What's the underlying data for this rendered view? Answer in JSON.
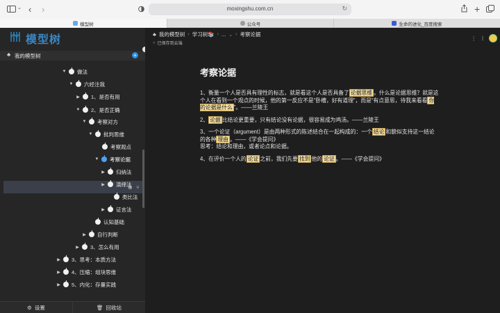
{
  "browser": {
    "url": "moxingshu.com.cn",
    "tabs": [
      {
        "label": "模型树",
        "color": "#6aa8e8"
      },
      {
        "label": "公众号",
        "color": "#9b9b9b"
      },
      {
        "label": "生命的进化_百度搜索",
        "color": "#3b5bdb"
      }
    ]
  },
  "sidebar": {
    "logo_text": "模型树",
    "my_tree_label": "我的模型树",
    "settings_label": "设置",
    "trash_label": "回收站"
  },
  "tree": [
    {
      "label": "做法",
      "arrow": "down",
      "bullet": "white"
    },
    {
      "label": "六经注我",
      "arrow": "down",
      "bullet": "white"
    },
    {
      "label": "1、是否有用",
      "arrow": "right",
      "bullet": "white"
    },
    {
      "label": "2、是否正确",
      "arrow": "down",
      "bullet": "white"
    },
    {
      "label": "考察对方",
      "arrow": "down",
      "bullet": "white"
    },
    {
      "label": "批判思维",
      "arrow": "down",
      "bullet": "white"
    },
    {
      "label": "考察观点",
      "arrow": "",
      "bullet": "white"
    },
    {
      "label": "考察论据",
      "arrow": "down",
      "bullet": "blue"
    },
    {
      "label": "归纳法",
      "arrow": "right",
      "bullet": "white"
    },
    {
      "label": "演绎法",
      "arrow": "right",
      "bullet": "white"
    },
    {
      "label": "类比法",
      "arrow": "",
      "bullet": "white"
    },
    {
      "label": "证言法",
      "arrow": "right",
      "bullet": "white"
    },
    {
      "label": "认知基础",
      "arrow": "",
      "bullet": "white"
    },
    {
      "label": "自行判断",
      "arrow": "right",
      "bullet": "white"
    },
    {
      "label": "3、怎么有用",
      "arrow": "right",
      "bullet": "white"
    },
    {
      "label": "3、思考：本质方法",
      "arrow": "right",
      "bullet": "white"
    },
    {
      "label": "4、压缩：组块思维",
      "arrow": "right",
      "bullet": "white"
    },
    {
      "label": "5、内化：存量实践",
      "arrow": "right",
      "bullet": "white"
    }
  ],
  "breadcrumb": [
    "我的模型树",
    "学习树📚",
    "...",
    "考察论据"
  ],
  "saved_status": "已保存到云端",
  "document": {
    "title": "考察论据",
    "paragraphs": [
      [
        {
          "t": "1、衡量一个人是否具有理性的标志，就是看这个人是否具备了"
        },
        {
          "t": "论据思维",
          "hl": true
        },
        {
          "t": "。什么是论据思维？就是这个人在看到一个观点的时候，他的第一反应不是“卧槽，好有道理”，而是“有点意思，待我来看看"
        },
        {
          "t": "你的论据是什么",
          "hl": true
        },
        {
          "t": "”。——兰陵王"
        }
      ],
      [
        {
          "t": "2、"
        },
        {
          "t": "论据",
          "hl": true
        },
        {
          "t": "比结论更重要，只有结论没有论据，很容易成为鸡汤。——兰陵王"
        }
      ],
      [
        {
          "t": "3、一个论证（argument）是由两种形式的陈述结合在一起构成的：一个"
        },
        {
          "t": "结论",
          "hl": true
        },
        {
          "t": "和貌似支持这一结论的各种"
        },
        {
          "t": "理由",
          "hl": true
        },
        {
          "t": "。——《学会提问》"
        },
        {
          "br": true
        },
        {
          "t": "思考：结论和理由，或者论点和论据。"
        }
      ],
      [
        {
          "t": "4、在评价一个人的"
        },
        {
          "t": "论证",
          "hl": true
        },
        {
          "t": "之前，我们先要"
        },
        {
          "t": "找到",
          "hl": true
        },
        {
          "t": "他的"
        },
        {
          "t": "论证",
          "hl": true
        },
        {
          "t": "。——《学会提问》"
        }
      ]
    ]
  }
}
